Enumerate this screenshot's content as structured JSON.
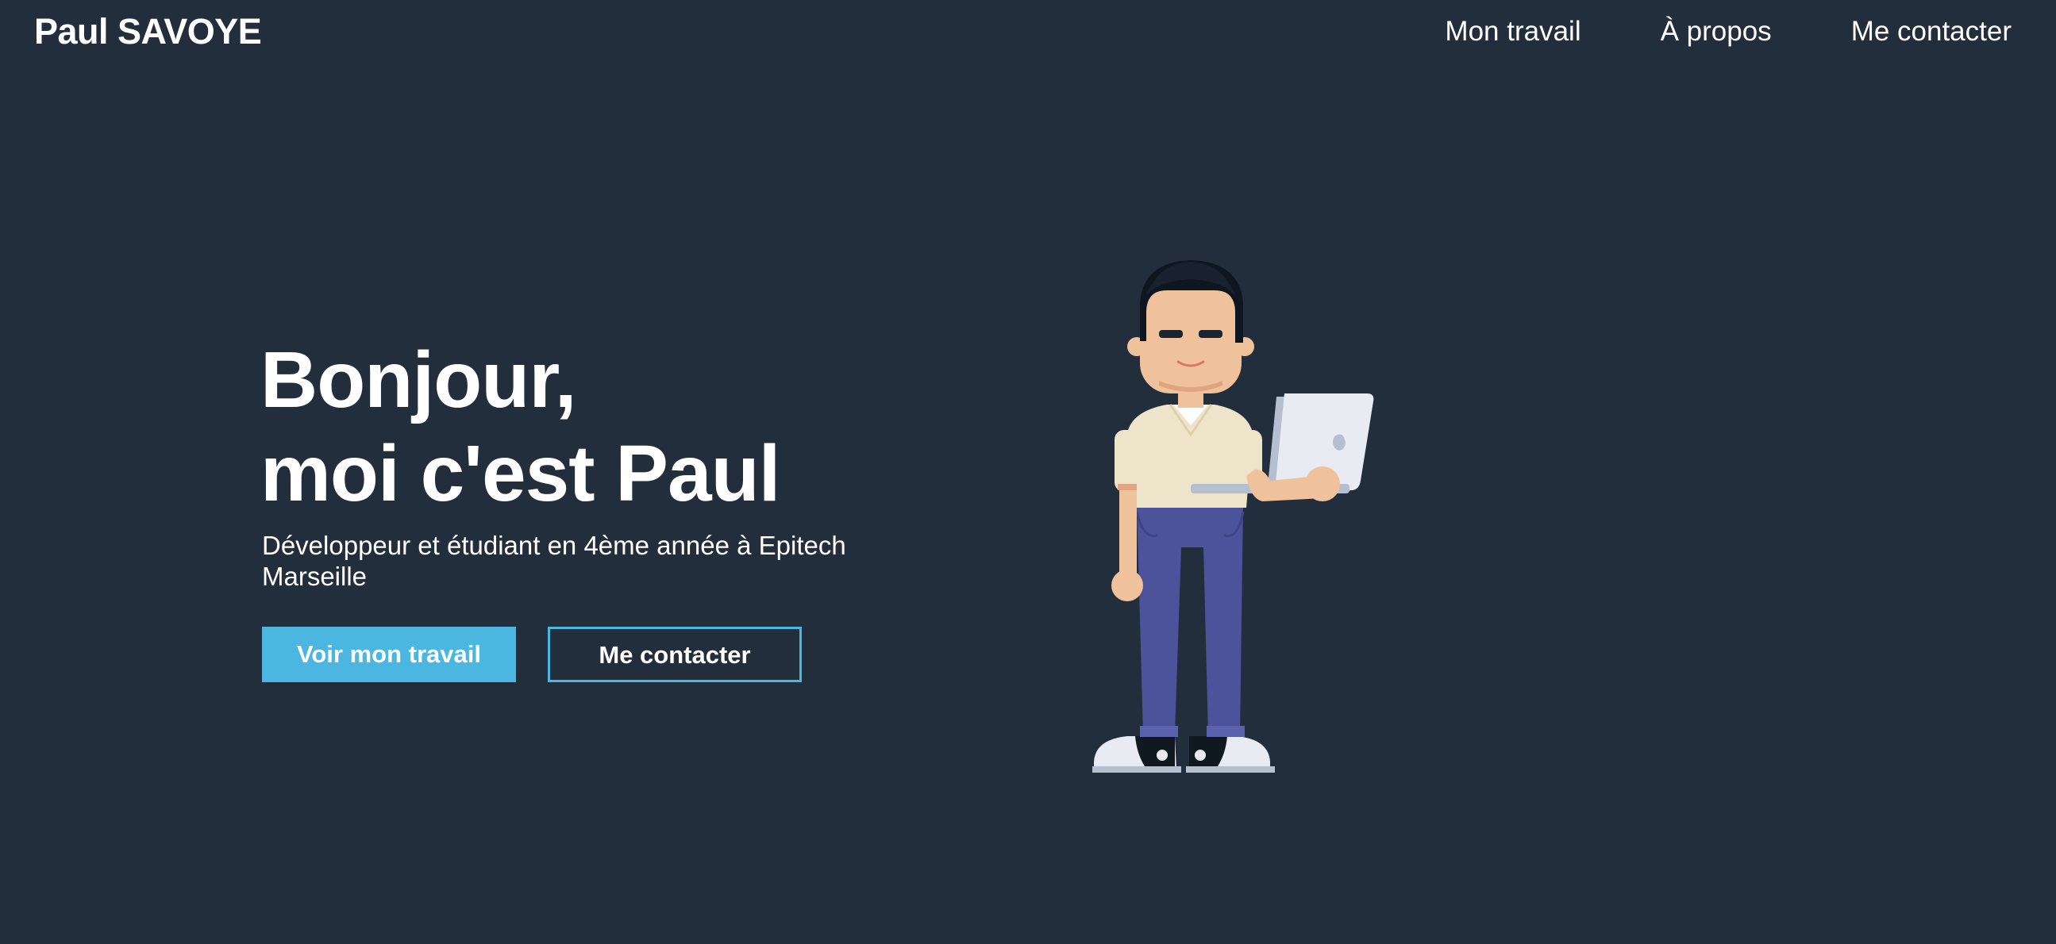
{
  "header": {
    "brand": "Paul SAVOYE",
    "nav": [
      {
        "label": "Mon travail"
      },
      {
        "label": "À propos"
      },
      {
        "label": "Me contacter"
      }
    ]
  },
  "hero": {
    "title_line1": "Bonjour,",
    "title_line2": "moi c'est Paul",
    "subtitle": "Développeur et étudiant en 4ème année à Epitech Marseille",
    "primary_button": "Voir mon travail",
    "secondary_button": "Me contacter"
  },
  "colors": {
    "background": "#232e3d",
    "accent": "#4bb6e0",
    "text": "#ffffff"
  },
  "illustration": {
    "icon": "developer-with-laptop-illustration"
  }
}
